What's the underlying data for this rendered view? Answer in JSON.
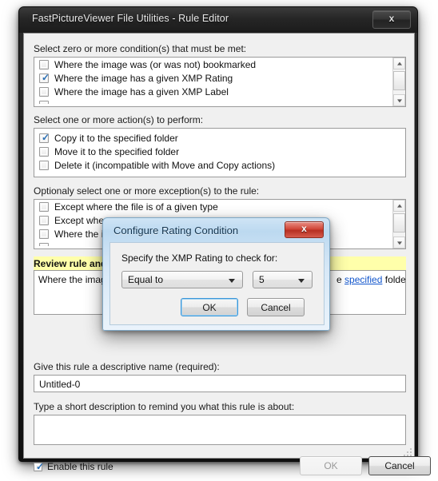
{
  "window": {
    "title": "FastPictureViewer File Utilities - Rule Editor",
    "close_glyph": "x"
  },
  "sections": {
    "conditions_label": "Select zero or more condition(s) that must be met:",
    "actions_label": "Select one or more action(s) to perform:",
    "exceptions_label": "Optionaly select one or more exception(s) to the rule:",
    "review_label": "Review rule and",
    "name_label": "Give this rule a descriptive name (required):",
    "description_label": "Type a short description to remind you what this rule is about:"
  },
  "conditions": [
    {
      "label": "Where the image was (or was not) bookmarked",
      "checked": false
    },
    {
      "label": "Where the image has a given XMP Rating",
      "checked": true
    },
    {
      "label": "Where the image has a given XMP Label",
      "checked": false
    }
  ],
  "actions": [
    {
      "label": "Copy it to the specified folder",
      "checked": true
    },
    {
      "label": "Move it to the specified folder",
      "checked": false
    },
    {
      "label": "Delete it (incompatible with Move and Copy actions)",
      "checked": false
    }
  ],
  "exceptions": [
    {
      "label": "Except where the file is of a given type",
      "checked": false
    },
    {
      "label": "Except where t",
      "checked": false
    },
    {
      "label": "Where the imag",
      "checked": false
    }
  ],
  "review": {
    "text_start": "Where the image",
    "text_link": "specified",
    "text_end": "folder.",
    "text_before_link": "e"
  },
  "rule_name": {
    "value": "Untitled-0"
  },
  "rule_description": {
    "value": ""
  },
  "footer": {
    "enable_label": "Enable this rule",
    "enable_checked": true,
    "ok_label": "OK",
    "cancel_label": "Cancel"
  },
  "modal": {
    "title": "Configure Rating Condition",
    "close_glyph": "x",
    "prompt": "Specify the XMP Rating to check for:",
    "operator_value": "Equal to",
    "rating_value": "5",
    "ok_label": "OK",
    "cancel_label": "Cancel"
  },
  "colors": {
    "banner_yellow": "#ffffaa",
    "link_blue": "#1155cc",
    "checkbox_blue": "#2a6fb5",
    "modal_close_red": "#c9402f"
  },
  "checkmark": "✓"
}
